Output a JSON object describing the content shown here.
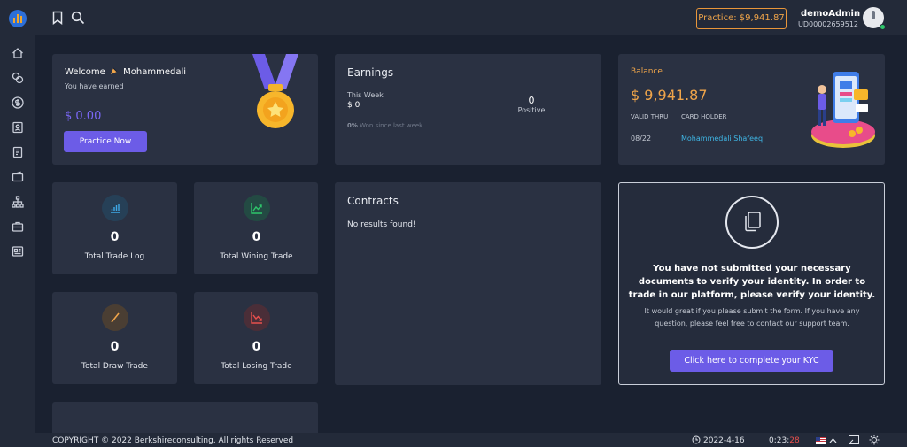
{
  "practice_label": "Practice: $9,941.87",
  "user": {
    "name": "demoAdmin",
    "id": "UD00002659512"
  },
  "welcome": {
    "greeting": "Welcome",
    "name": "Mohammedali",
    "earned_label": "You have earned",
    "amount": "$ 0.00",
    "button": "Practice Now"
  },
  "earnings": {
    "title": "Earnings",
    "week_label": "This Week",
    "week_value": "$ 0",
    "positive_value": "0",
    "positive_label": "Positive",
    "won_pct": "0%",
    "won_text": "Won since last week"
  },
  "balance": {
    "label": "Balance",
    "amount": "$ 9,941.87",
    "valid_thru_label": "VALID THRU",
    "card_holder_label": "CARD HOLDER",
    "valid_thru": "08/22",
    "card_holder": "Mohammedali Shafeeq"
  },
  "stats": [
    {
      "value": "0",
      "label": "Total Trade Log",
      "icon": "bar-chart-icon",
      "color": "#3fa9e6"
    },
    {
      "value": "0",
      "label": "Total Wining Trade",
      "icon": "trend-up-icon",
      "color": "#2ec66b"
    },
    {
      "value": "0",
      "label": "Total Draw Trade",
      "icon": "slash-icon",
      "color": "#f0a54a"
    },
    {
      "value": "0",
      "label": "Total Losing Trade",
      "icon": "trend-down-icon",
      "color": "#e8504d"
    }
  ],
  "contracts": {
    "title": "Contracts",
    "empty": "No results found!"
  },
  "kyc": {
    "title": "You have not submitted your necessary documents to verify your identity. In order to trade in our platform, please verify your identity.",
    "desc": "It would great if you please submit the form. If you have any question, please feel free to contact our support team.",
    "button": "Click here to complete your KYC"
  },
  "footer": {
    "copyright": "COPYRIGHT © 2022 Berkshireconsulting, All rights Reserved",
    "date": "2022-4-16",
    "time_main": "0:23:",
    "time_sec": "28"
  },
  "colors": {
    "accent": "#6c5ce7",
    "orange": "#f0a54a",
    "bg": "#1a2130",
    "card": "#2a3142"
  }
}
